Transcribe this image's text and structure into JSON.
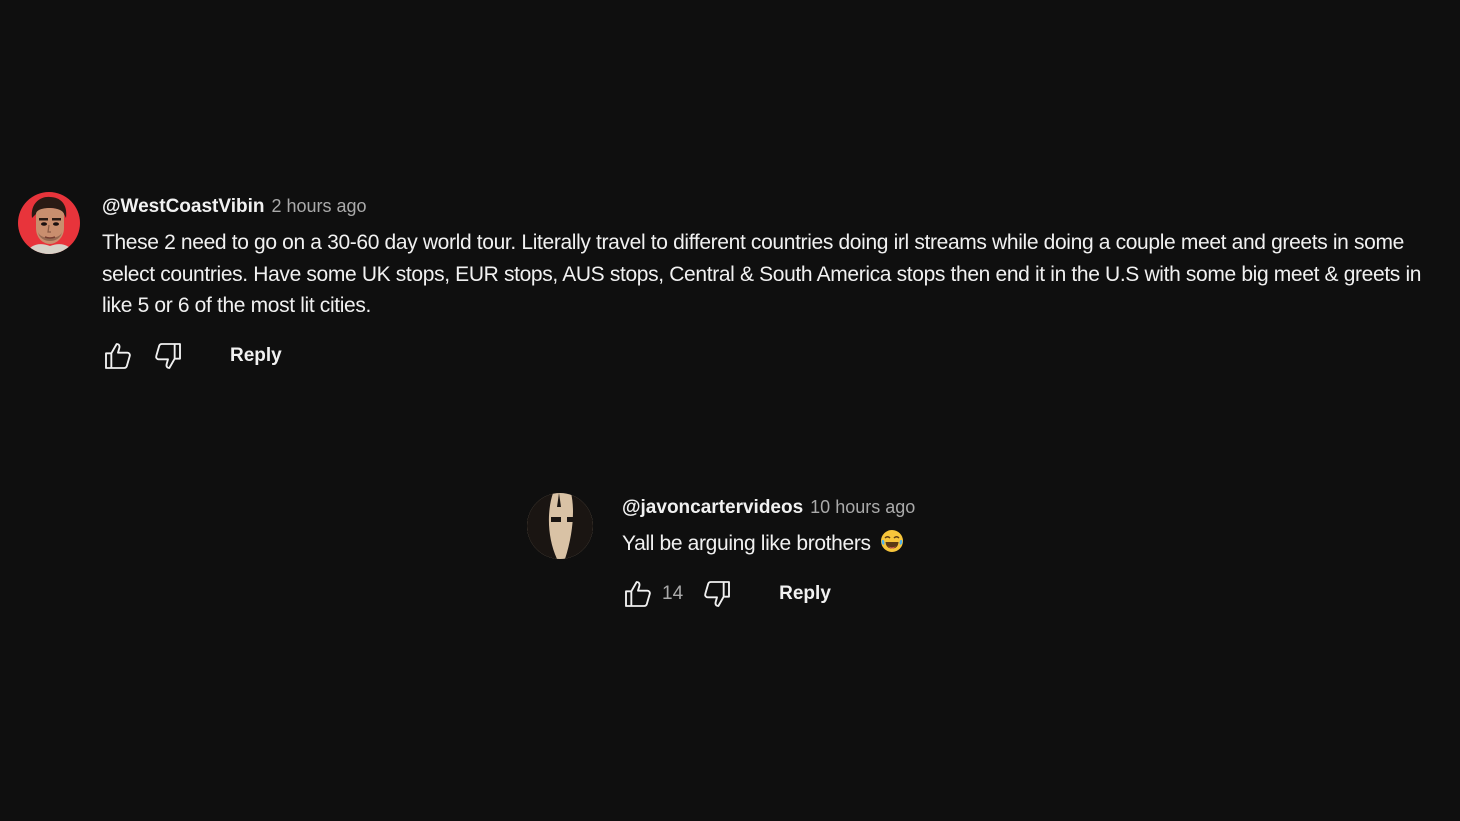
{
  "comments": [
    {
      "author": "@WestCoastVibin",
      "time": "2 hours ago",
      "text": "These 2 need to go on a 30-60 day world tour. Literally travel to different countries doing irl streams while doing a couple meet and greets in some select countries. Have some UK stops, EUR stops, AUS stops, Central & South America stops then end it in the U.S with some big meet & greets in like 5 or 6 of the most lit cities.",
      "like_count": "",
      "reply_label": "Reply",
      "avatar_bg": "#e8343b"
    },
    {
      "author": "@javoncartervideos",
      "time": "10 hours ago",
      "text": "Yall be arguing like brothers",
      "emoji": "face-with-tears-of-joy",
      "like_count": "14",
      "reply_label": "Reply",
      "avatar_bg": "#d9c2a5"
    }
  ],
  "colors": {
    "background": "#0f0f0f",
    "text_primary": "#f1f1f1",
    "text_secondary": "#aaaaaa"
  },
  "icons": {
    "like": "thumbs-up-icon",
    "dislike": "thumbs-down-icon"
  }
}
